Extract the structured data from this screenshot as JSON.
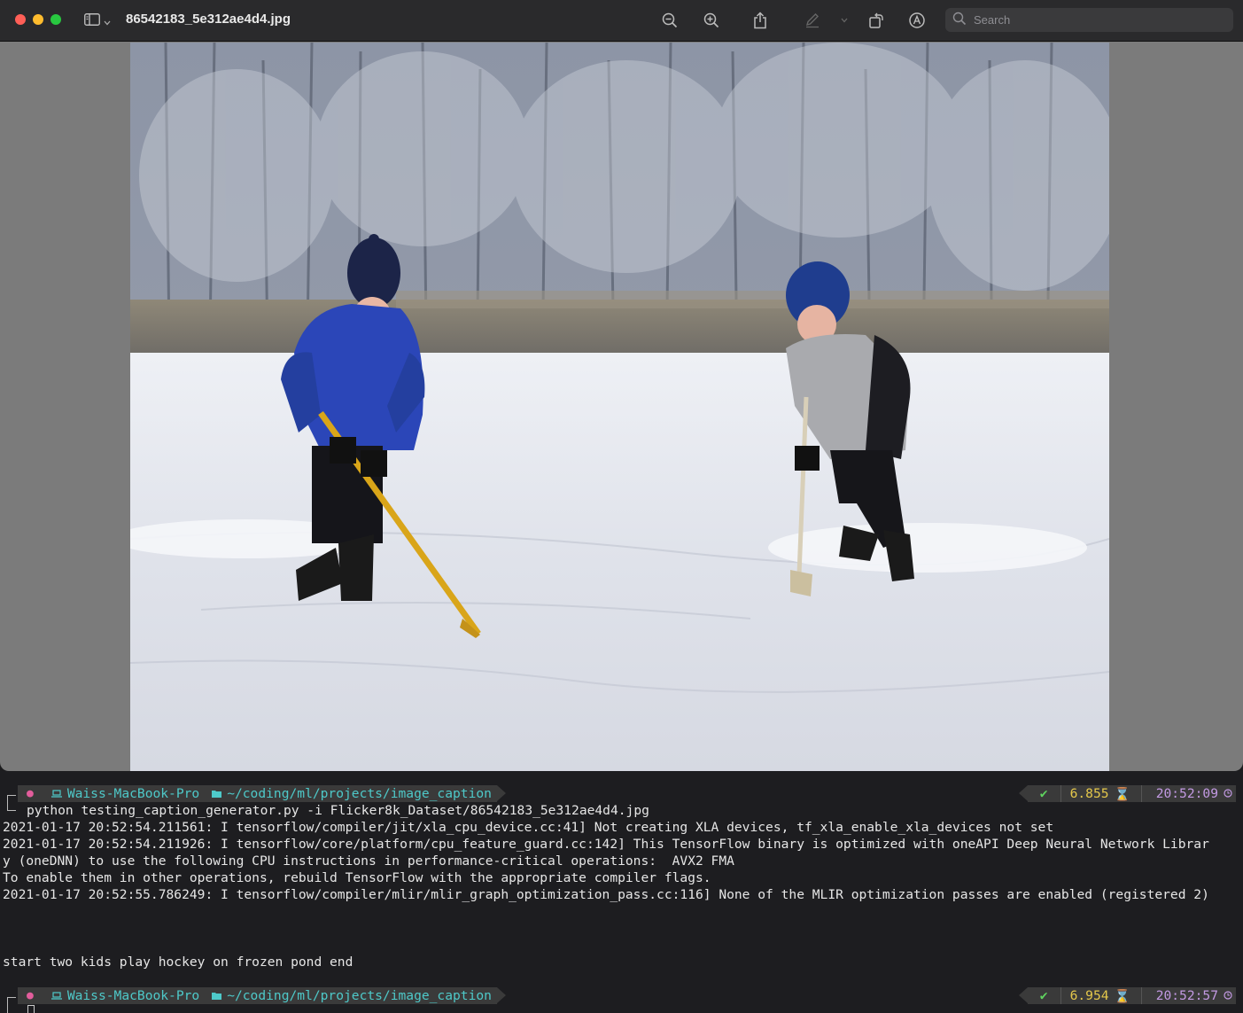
{
  "window": {
    "title": "86542183_5e312ae4d4.jpg",
    "search_placeholder": "Search"
  },
  "toolbar": {
    "icons": [
      "sidebar-icon",
      "chevron-down-icon",
      "zoom-out-icon",
      "zoom-in-icon",
      "share-icon",
      "markup-pen-icon",
      "chevron-down-icon",
      "rotate-icon",
      "annotate-icon",
      "search-icon"
    ]
  },
  "terminal": {
    "prompt1": {
      "host": "Waiss-MacBook-Pro",
      "path": "~/coding/ml/projects/image_caption",
      "status": "✔",
      "duration": "6.855",
      "time": "20:52:09"
    },
    "command": "python testing_caption_generator.py -i Flicker8k_Dataset/86542183_5e312ae4d4.jpg",
    "output": [
      "2021-01-17 20:52:54.211561: I tensorflow/compiler/jit/xla_cpu_device.cc:41] Not creating XLA devices, tf_xla_enable_xla_devices not set",
      "2021-01-17 20:52:54.211926: I tensorflow/core/platform/cpu_feature_guard.cc:142] This TensorFlow binary is optimized with oneAPI Deep Neural Network Librar",
      "y (oneDNN) to use the following CPU instructions in performance-critical operations:  AVX2 FMA",
      "To enable them in other operations, rebuild TensorFlow with the appropriate compiler flags.",
      "2021-01-17 20:52:55.786249: I tensorflow/compiler/mlir/mlir_graph_optimization_pass.cc:116] None of the MLIR optimization passes are enabled (registered 2)"
    ],
    "caption": "start two kids play hockey on frozen pond end",
    "prompt2": {
      "host": "Waiss-MacBook-Pro",
      "path": "~/coding/ml/projects/image_caption",
      "status": "✔",
      "duration": "6.954",
      "time": "20:52:57"
    }
  },
  "colors": {
    "terminal_bg": "#1d1d20",
    "prompt_cyan": "#4ec9c9",
    "duration_yellow": "#e5c84b",
    "time_purple": "#c39ae3",
    "ok_green": "#5fd35f",
    "apple_pink": "#e25d9c"
  }
}
